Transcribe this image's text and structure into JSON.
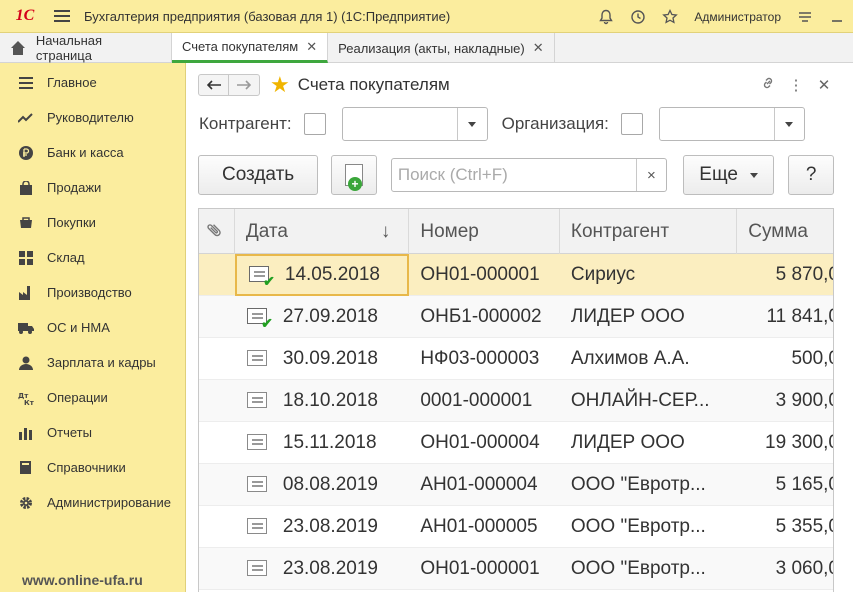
{
  "app": {
    "logo": "1С",
    "title": "Бухгалтерия предприятия (базовая для 1)  (1С:Предприятие)",
    "user": "Администратор"
  },
  "tabs": [
    {
      "label": "Начальная страница"
    },
    {
      "label": "Счета покупателям"
    },
    {
      "label": "Реализация (акты, накладные)"
    }
  ],
  "sidebar": {
    "items": [
      {
        "label": "Главное",
        "icon": "menu-lines-icon"
      },
      {
        "label": "Руководителю",
        "icon": "trend-icon"
      },
      {
        "label": "Банк и касса",
        "icon": "ruble-coin-icon"
      },
      {
        "label": "Продажи",
        "icon": "shopping-bag-icon"
      },
      {
        "label": "Покупки",
        "icon": "cart-icon"
      },
      {
        "label": "Склад",
        "icon": "warehouse-grid-icon"
      },
      {
        "label": "Производство",
        "icon": "factory-icon"
      },
      {
        "label": "ОС и НМА",
        "icon": "truck-icon"
      },
      {
        "label": "Зарплата и кадры",
        "icon": "person-icon"
      },
      {
        "label": "Операции",
        "icon": "dt-kt-icon"
      },
      {
        "label": "Отчеты",
        "icon": "bar-chart-icon"
      },
      {
        "label": "Справочники",
        "icon": "book-icon"
      },
      {
        "label": "Администрирование",
        "icon": "gear-icon"
      }
    ],
    "watermark": "www.online-ufa.ru"
  },
  "form": {
    "title": "Счета покупателям",
    "filters": {
      "counterparty_label": "Контрагент:",
      "organization_label": "Организация:"
    },
    "toolbar": {
      "create_label": "Создать",
      "search_placeholder": "Поиск (Ctrl+F)",
      "clear_label": "×",
      "more_label": "Еще",
      "help_label": "?"
    },
    "table": {
      "columns": [
        "Дата",
        "Номер",
        "Контрагент",
        "Сумма"
      ],
      "sort_indicator": "↓",
      "rows": [
        {
          "date": "14.05.2018",
          "number": "ОН01-000001",
          "counterparty": "Сириус",
          "amount": "5 870,0",
          "posted": true
        },
        {
          "date": "27.09.2018",
          "number": "ОНБ1-000002",
          "counterparty": "ЛИДЕР ООО",
          "amount": "11 841,0",
          "posted": true
        },
        {
          "date": "30.09.2018",
          "number": "НФ03-000003",
          "counterparty": "Алхимов А.А.",
          "amount": "500,0",
          "posted": false
        },
        {
          "date": "18.10.2018",
          "number": "0001-000001",
          "counterparty": "ОНЛАЙН-СЕР...",
          "amount": "3 900,0",
          "posted": false
        },
        {
          "date": "15.11.2018",
          "number": "ОН01-000004",
          "counterparty": "ЛИДЕР ООО",
          "amount": "19 300,0",
          "posted": false
        },
        {
          "date": "08.08.2019",
          "number": "АН01-000004",
          "counterparty": "ООО \"Евротр...",
          "amount": "5 165,0",
          "posted": false
        },
        {
          "date": "23.08.2019",
          "number": "АН01-000005",
          "counterparty": "ООО \"Евротр...",
          "amount": "5 355,0",
          "posted": false
        },
        {
          "date": "23.08.2019",
          "number": "ОН01-000001",
          "counterparty": "ООО \"Евротр...",
          "amount": "3 060,0",
          "posted": false
        }
      ]
    }
  }
}
